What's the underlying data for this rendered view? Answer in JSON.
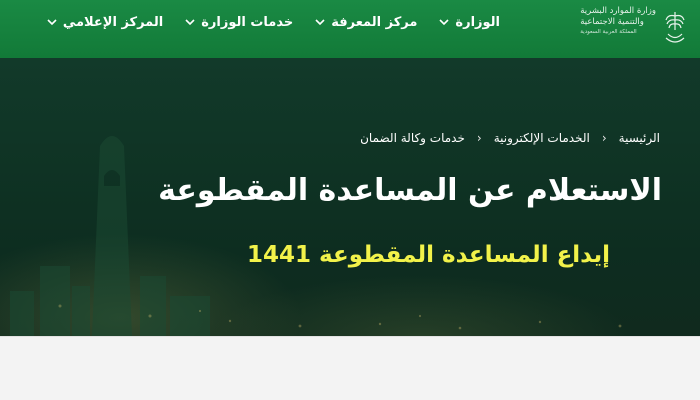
{
  "header": {
    "logo": {
      "line1": "وزارة الموارد البشرية",
      "line2": "والتنمية الاجتماعية",
      "line3": "المملكة العربية السعودية"
    },
    "nav": [
      {
        "label": "الوزارة",
        "icon": "chevron-down-icon"
      },
      {
        "label": "مركز المعرفة",
        "icon": "chevron-down-icon"
      },
      {
        "label": "خدمات الوزارة",
        "icon": "chevron-down-icon"
      },
      {
        "label": "المركز الإعلامي",
        "icon": "chevron-down-icon"
      }
    ]
  },
  "hero": {
    "breadcrumb": [
      {
        "label": "الرئيسية"
      },
      {
        "label": "الخدمات الإلكترونية"
      },
      {
        "label": "خدمات وكالة الضمان"
      }
    ],
    "title": "الاستعلام عن المساعدة المقطوعة",
    "subtitle": "إيداع المساعدة المقطوعة 1441"
  },
  "colors": {
    "header_green": "#1a8a44",
    "hero_dark": "#0f3324",
    "subtitle_yellow": "#f2f24a",
    "content_bg": "#f3f3f3"
  }
}
